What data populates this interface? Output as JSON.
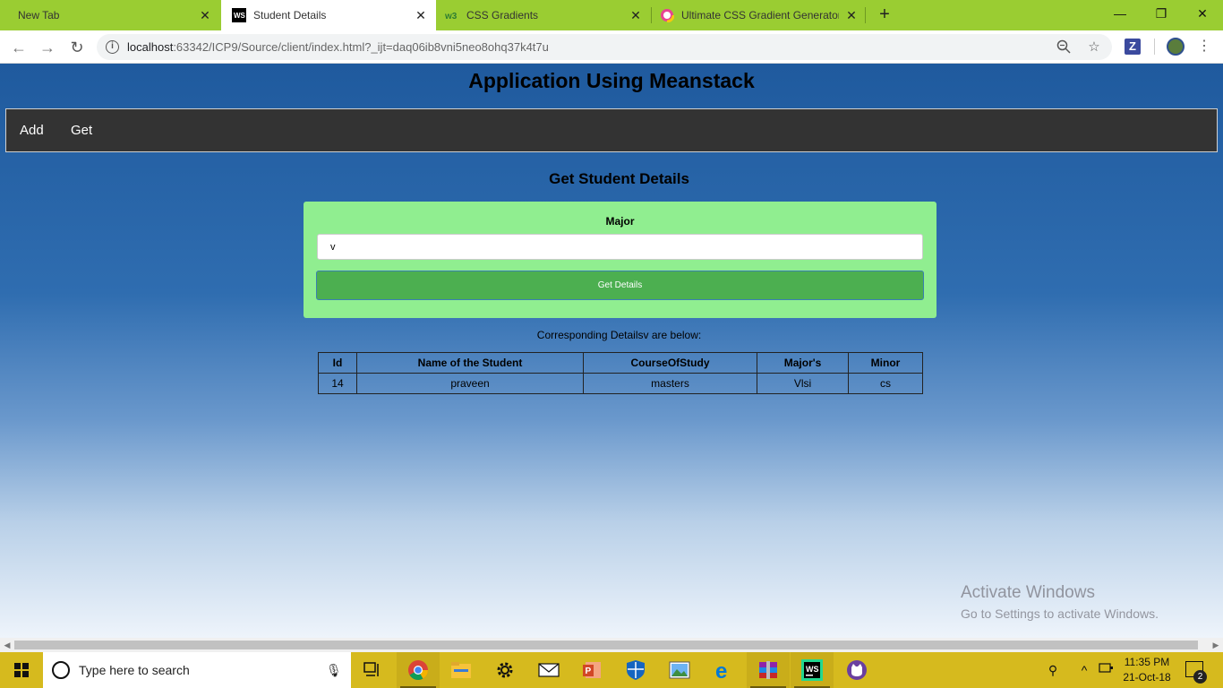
{
  "browser": {
    "tabs": [
      {
        "title": "New Tab",
        "active": false,
        "icon": "none"
      },
      {
        "title": "Student Details",
        "active": true,
        "icon": "webstorm-icon"
      },
      {
        "title": "CSS Gradients",
        "active": false,
        "icon": "w3schools-icon"
      },
      {
        "title": "Ultimate CSS Gradient Generator",
        "active": false,
        "icon": "color-wheel-icon"
      }
    ],
    "url_host": "localhost",
    "url_rest": ":63342/ICP9/Source/client/index.html?_ijt=daq06ib8vni5neo8ohq37k4t7u",
    "extension_letter": "Z",
    "colors": {
      "tabstrip": "#9acd32",
      "toolbar": "#ffffff"
    }
  },
  "page": {
    "app_title": "Application Using Meanstack",
    "nav": {
      "add": "Add",
      "get": "Get"
    },
    "section_title": "Get Student Details",
    "form": {
      "label": "Major",
      "input_value": "v",
      "button_label": "Get Details"
    },
    "result_text": "Corresponding Detailsv are below:",
    "table": {
      "headers": [
        "Id",
        "Name of the Student",
        "CourseOfStudy",
        "Major's",
        "Minor"
      ],
      "rows": [
        [
          "14",
          "praveen",
          "masters",
          "Vlsi",
          "cs"
        ]
      ]
    },
    "watermark": {
      "line1": "Activate Windows",
      "line2": "Go to Settings to activate Windows."
    },
    "colors": {
      "nav_bg": "#333333",
      "card_bg": "#90ee90",
      "button_bg": "#4caf50"
    }
  },
  "taskbar": {
    "search_placeholder": "Type here to search",
    "time": "11:35 PM",
    "date": "21-Oct-18",
    "notification_count": "2",
    "pinned": [
      "task-view-icon",
      "chrome-icon",
      "file-explorer-icon",
      "settings-icon",
      "mail-icon",
      "powerpoint-icon",
      "defender-icon",
      "photos-icon",
      "edge-icon",
      "winrar-icon",
      "webstorm-icon",
      "app-icon"
    ],
    "color": "#d6ba1e"
  }
}
